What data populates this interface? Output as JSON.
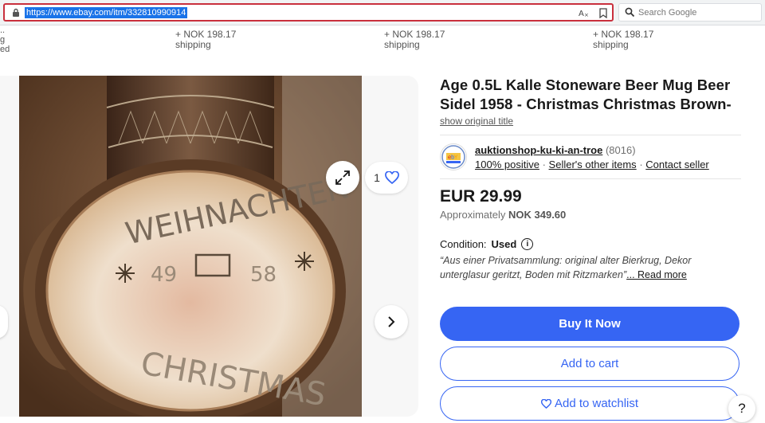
{
  "browser": {
    "url": "https://www.ebay.com/itm/332810990914",
    "search_placeholder": "Search Google"
  },
  "shipping_strip": {
    "left_cut_lines": [
      "..",
      "g",
      "ed"
    ],
    "items": [
      {
        "price": "+ NOK 198.17",
        "label": "shipping"
      },
      {
        "price": "+ NOK 198.17",
        "label": "shipping"
      },
      {
        "price": "+ NOK 198.17",
        "label": "shipping"
      }
    ]
  },
  "gallery": {
    "watch_count": "1",
    "photo_text": "WEIHNACHTEN 49 58 CHRISTMAS"
  },
  "item": {
    "title": "Age 0.5L Kalle Stoneware Beer Mug Beer Sidel 1958 - Christmas Christmas Brown-",
    "show_original_title": "show original title",
    "seller": {
      "name": "auktionshop-ku-ki-an-troe",
      "score": "(8016)",
      "positive": "100% positive",
      "other_items": "Seller's other items",
      "contact": "Contact seller"
    },
    "price": "EUR 29.99",
    "approx_label": "Approximately",
    "approx_value": "NOK 349.60",
    "condition_label": "Condition:",
    "condition_value": "Used",
    "condition_quote": "“Aus einer Privatsammlung: original alter Bierkrug, Dekor unterglasur geritzt, Boden mit Ritzmarken”",
    "read_more": "... Read more",
    "buy_now": "Buy It Now",
    "add_to_cart": "Add to cart",
    "add_to_watchlist": "Add to watchlist",
    "help": "?"
  },
  "colors": {
    "accent": "#3665f3",
    "url_border": "#c9303d"
  }
}
